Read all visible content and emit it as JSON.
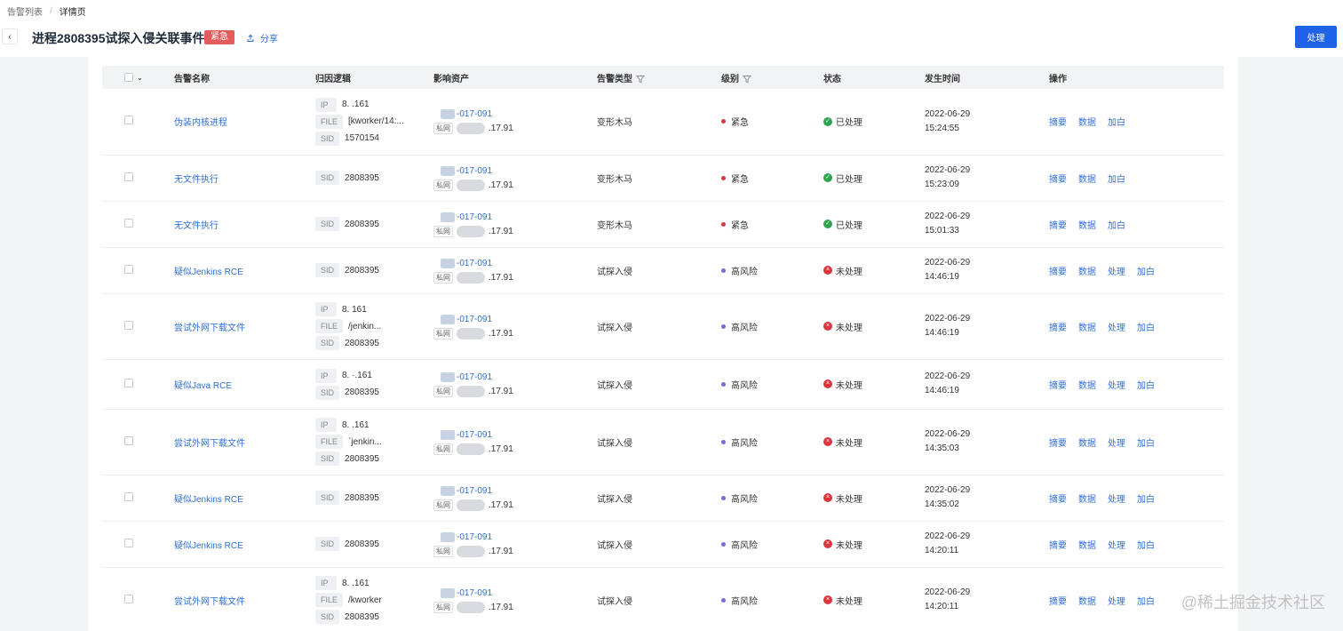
{
  "breadcrumb": {
    "root": "告警列表",
    "separator": "/",
    "current": "详情页"
  },
  "header": {
    "title": "进程2808395试探入侵关联事件",
    "tag": "紧急",
    "share": "分享",
    "process_button": "处理"
  },
  "table": {
    "columns": {
      "name": "告警名称",
      "logic": "归因逻辑",
      "asset": "影响资产",
      "type": "告警类型",
      "level": "级别",
      "status": "状态",
      "time": "发生时间",
      "ops": "操作"
    },
    "rows": [
      {
        "name": "伪装内核进程",
        "attrs": [
          {
            "k": "IP",
            "v": "8.            .161"
          },
          {
            "k": "FILE",
            "v": "[kworker/14:..."
          },
          {
            "k": "SID",
            "v": "1570154"
          }
        ],
        "asset_host": "-017-091",
        "asset_tag": "私网",
        "asset_ip": ".17.91",
        "type": "变形木马",
        "level": "紧急",
        "level_color": "#d9363e",
        "status": "已处理",
        "status_color": "#2da44e",
        "date": "2022-06-29",
        "clock": "15:24:55",
        "ops": [
          "摘要",
          "数据",
          "加白"
        ]
      },
      {
        "name": "无文件执行",
        "attrs": [
          {
            "k": "SID",
            "v": "2808395"
          }
        ],
        "asset_host": "-017-091",
        "asset_tag": "私网",
        "asset_ip": ".17.91",
        "type": "变形木马",
        "level": "紧急",
        "level_color": "#d9363e",
        "status": "已处理",
        "status_color": "#2da44e",
        "date": "2022-06-29",
        "clock": "15:23:09",
        "ops": [
          "摘要",
          "数据",
          "加白"
        ]
      },
      {
        "name": "无文件执行",
        "attrs": [
          {
            "k": "SID",
            "v": "2808395"
          }
        ],
        "asset_host": "-017-091",
        "asset_tag": "私网",
        "asset_ip": ".17.91",
        "type": "变形木马",
        "level": "紧急",
        "level_color": "#d9363e",
        "status": "已处理",
        "status_color": "#2da44e",
        "date": "2022-06-29",
        "clock": "15:01:33",
        "ops": [
          "摘要",
          "数据",
          "加白"
        ]
      },
      {
        "name": "疑似Jenkins RCE",
        "attrs": [
          {
            "k": "SID",
            "v": "2808395"
          }
        ],
        "asset_host": "-017-091",
        "asset_tag": "私网",
        "asset_ip": ".17.91",
        "type": "试探入侵",
        "level": "高风险",
        "level_color": "#7a6ad8",
        "status": "未处理",
        "status_color": "#d9363e",
        "date": "2022-06-29",
        "clock": "14:46:19",
        "ops": [
          "摘要",
          "数据",
          "处理",
          "加白"
        ]
      },
      {
        "name": "尝试外网下载文件",
        "attrs": [
          {
            "k": "IP",
            "v": "8.            161"
          },
          {
            "k": "FILE",
            "v": "/jenkin..."
          },
          {
            "k": "SID",
            "v": "2808395"
          }
        ],
        "asset_host": "-017-091",
        "asset_tag": "私网",
        "asset_ip": ".17.91",
        "type": "试探入侵",
        "level": "高风险",
        "level_color": "#7a6ad8",
        "status": "未处理",
        "status_color": "#d9363e",
        "date": "2022-06-29",
        "clock": "14:46:19",
        "ops": [
          "摘要",
          "数据",
          "处理",
          "加白"
        ]
      },
      {
        "name": "疑似Java RCE",
        "attrs": [
          {
            "k": "IP",
            "v": "8.            ·.161"
          },
          {
            "k": "SID",
            "v": "2808395"
          }
        ],
        "asset_host": "-017-091",
        "asset_tag": "私网",
        "asset_ip": ".17.91",
        "type": "试探入侵",
        "level": "高风险",
        "level_color": "#7a6ad8",
        "status": "未处理",
        "status_color": "#d9363e",
        "date": "2022-06-29",
        "clock": "14:46:19",
        "ops": [
          "摘要",
          "数据",
          "处理",
          "加白"
        ]
      },
      {
        "name": "尝试外网下载文件",
        "attrs": [
          {
            "k": "IP",
            "v": "8.            .161"
          },
          {
            "k": "FILE",
            "v": "`jenkin..."
          },
          {
            "k": "SID",
            "v": "2808395"
          }
        ],
        "asset_host": "-017-091",
        "asset_tag": "私网",
        "asset_ip": ".17.91",
        "type": "试探入侵",
        "level": "高风险",
        "level_color": "#7a6ad8",
        "status": "未处理",
        "status_color": "#d9363e",
        "date": "2022-06-29",
        "clock": "14:35:03",
        "ops": [
          "摘要",
          "数据",
          "处理",
          "加白"
        ]
      },
      {
        "name": "疑似Jenkins RCE",
        "attrs": [
          {
            "k": "SID",
            "v": "2808395"
          }
        ],
        "asset_host": "-017-091",
        "asset_tag": "私网",
        "asset_ip": ".17.91",
        "type": "试探入侵",
        "level": "高风险",
        "level_color": "#7a6ad8",
        "status": "未处理",
        "status_color": "#d9363e",
        "date": "2022-06-29",
        "clock": "14:35:02",
        "ops": [
          "摘要",
          "数据",
          "处理",
          "加白"
        ]
      },
      {
        "name": "疑似Jenkins RCE",
        "attrs": [
          {
            "k": "SID",
            "v": "2808395"
          }
        ],
        "asset_host": "-017-091",
        "asset_tag": "私网",
        "asset_ip": ".17.91",
        "type": "试探入侵",
        "level": "高风险",
        "level_color": "#7a6ad8",
        "status": "未处理",
        "status_color": "#d9363e",
        "date": "2022-06-29",
        "clock": "14:20:11",
        "ops": [
          "摘要",
          "数据",
          "处理",
          "加白"
        ]
      },
      {
        "name": "尝试外网下载文件",
        "attrs": [
          {
            "k": "IP",
            "v": "8.            .161"
          },
          {
            "k": "FILE",
            "v": "/kworker"
          },
          {
            "k": "SID",
            "v": "2808395"
          }
        ],
        "asset_host": "-017-091",
        "asset_tag": "私网",
        "asset_ip": ".17.91",
        "type": "试探入侵",
        "level": "高风险",
        "level_color": "#7a6ad8",
        "status": "未处理",
        "status_color": "#d9363e",
        "date": "2022-06-29",
        "clock": "14:20:11",
        "ops": [
          "摘要",
          "数据",
          "处理",
          "加白"
        ]
      }
    ]
  },
  "watermark": "@稀土掘金技术社区"
}
